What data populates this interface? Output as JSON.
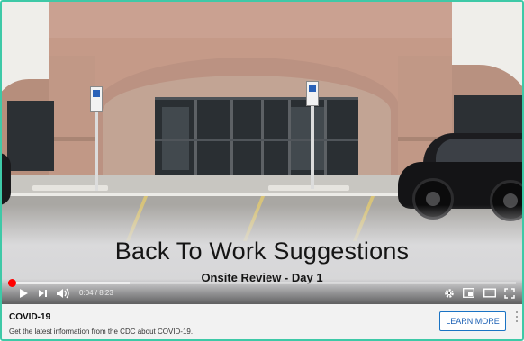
{
  "video": {
    "overlay_title": "Back To Work Suggestions",
    "overlay_subtitle": "Onsite Review - Day 1"
  },
  "player": {
    "current_time": "0:04",
    "duration": "8:23",
    "time_display": "0:04 / 8:23",
    "progress_fraction": 0.008,
    "buffer_fraction": 0.24,
    "accent_color": "#ff0000",
    "icons": [
      "play-icon",
      "next-icon",
      "volume-icon",
      "settings-icon",
      "miniplayer-icon",
      "theater-icon",
      "fullscreen-icon"
    ]
  },
  "info_panel": {
    "title": "COVID-19",
    "description": "Get the latest information from the CDC about COVID-19.",
    "button_label": "LEARN MORE",
    "button_color": "#1a73c4",
    "menu_icon": "more-vert-icon"
  }
}
